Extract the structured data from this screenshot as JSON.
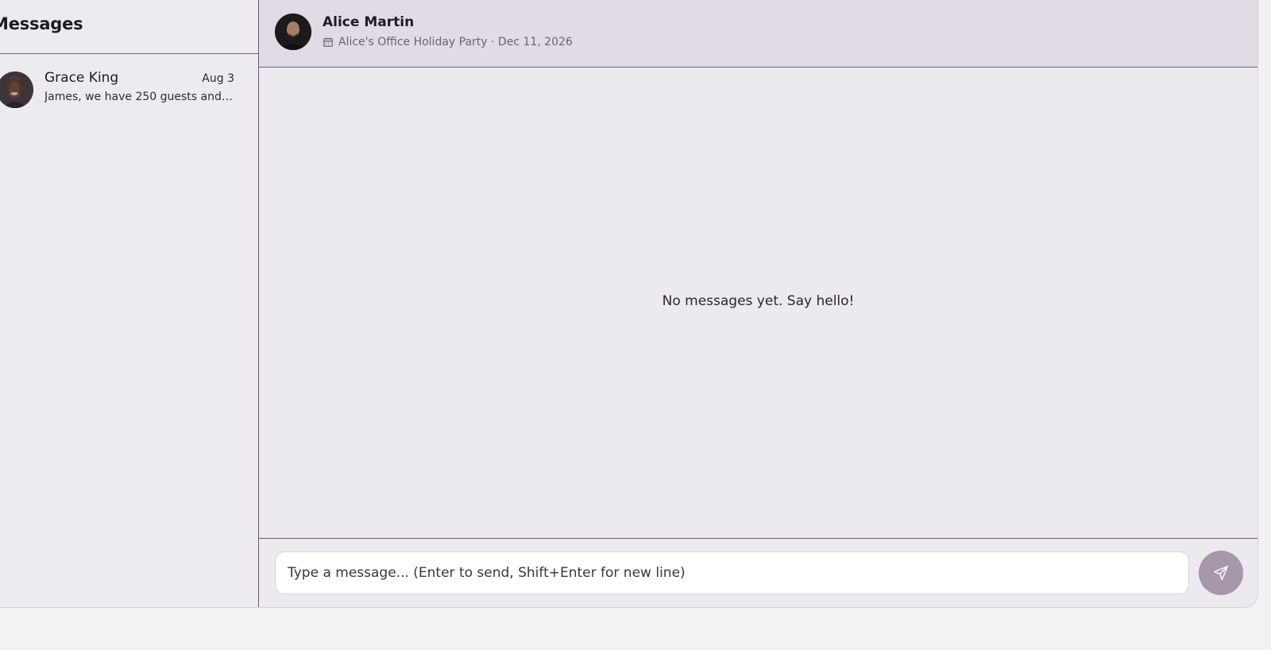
{
  "sidebar": {
    "title": "Messages",
    "conversations": [
      {
        "name": "Grace King",
        "date": "Aug 3",
        "preview": "James, we have 250 guests and n..."
      }
    ]
  },
  "chat": {
    "contact_name": "Alice Martin",
    "event_label": "Alice's Office Holiday Party · Dec 11, 2026",
    "event_icon": "calendar-icon",
    "empty_state": "No messages yet. Say hello!",
    "composer": {
      "placeholder": "Type a message... (Enter to send, Shift+Enter for new line)",
      "send_icon": "send-icon"
    }
  },
  "colors": {
    "accent": "#a697ab",
    "divider": "#6f5a78",
    "header_bg": "#e1dbe6",
    "page_bg": "#ece9ef"
  }
}
